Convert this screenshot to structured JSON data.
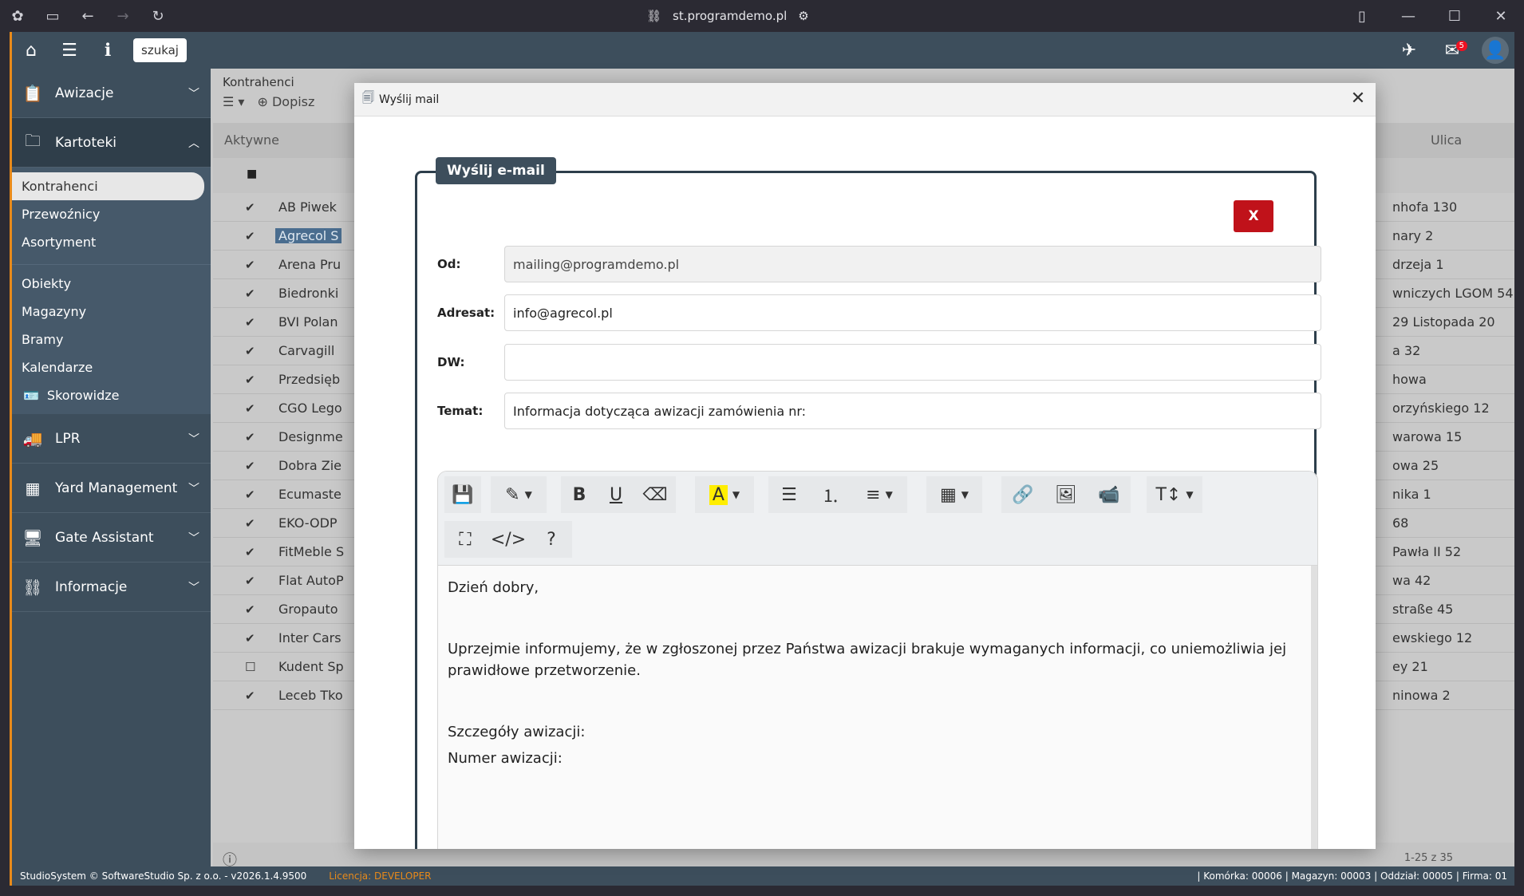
{
  "browser": {
    "url": "st.programdemo.pl"
  },
  "topbar": {
    "search_label": "szukaj",
    "mail_badge": "5"
  },
  "sidebar": {
    "sections": [
      {
        "label": "Awizacje"
      },
      {
        "label": "Kartoteki"
      },
      {
        "label": "LPR"
      },
      {
        "label": "Yard Management"
      },
      {
        "label": "Gate Assistant"
      },
      {
        "label": "Informacje"
      }
    ],
    "kartoteki_items": [
      "Kontrahenci",
      "Przewoźnicy",
      "Asortyment",
      "Obiekty",
      "Magazyny",
      "Bramy",
      "Kalendarze",
      "Skorowidze"
    ]
  },
  "content": {
    "breadcrumb": "Kontrahenci",
    "add_label": "Dopisz",
    "columns": {
      "active": "Aktywne",
      "street": "Ulica"
    },
    "rows": [
      {
        "name": "AB Piwek",
        "street": "nhofa 130",
        "checked": true
      },
      {
        "name": "Agrecol S",
        "street": "nary 2",
        "checked": true
      },
      {
        "name": "Arena Pru",
        "street": "drzeja 1",
        "checked": true
      },
      {
        "name": "Biedronki",
        "street": "wniczych LGOM 54",
        "checked": true
      },
      {
        "name": "BVI Polan",
        "street": "29 Listopada 20",
        "checked": true
      },
      {
        "name": "Carvagill",
        "street": "a 32",
        "checked": true
      },
      {
        "name": "Przedsięb",
        "street": "howa",
        "checked": true
      },
      {
        "name": "CGO Lego",
        "street": "orzyńskiego 12",
        "checked": true
      },
      {
        "name": "Designme",
        "street": "warowa 15",
        "checked": true
      },
      {
        "name": "Dobra Zie",
        "street": "owa 25",
        "checked": true
      },
      {
        "name": "Ecumaste",
        "street": "nika 1",
        "checked": true
      },
      {
        "name": "EKO-ODP",
        "street": "68",
        "checked": true
      },
      {
        "name": "FitMeble S",
        "street": "Pawła II 52",
        "checked": true
      },
      {
        "name": "Flat AutoP",
        "street": "wa 42",
        "checked": true
      },
      {
        "name": "Gropauto",
        "street": "straße 45",
        "checked": true
      },
      {
        "name": "Inter Cars",
        "street": "ewskiego 12",
        "checked": true
      },
      {
        "name": "Kudent Sp",
        "street": "ey 21",
        "checked": false
      },
      {
        "name": "Leceb Tko",
        "street": "ninowa 2",
        "checked": true
      }
    ],
    "pager_info": "1-25 z 35"
  },
  "status": {
    "copyright": "StudioSystem © SoftwareStudio Sp. z o.o. - v2026.1.4.9500",
    "license_label": "Licencja:",
    "license_value": "DEVELOPER",
    "right": "| Komórka: 00006 | Magazyn: 00003 | Oddział: 00005 | Firma: 01"
  },
  "modal": {
    "title": "Wyślij mail",
    "panel_title": "Wyślij e-mail",
    "x_label": "X",
    "fields": {
      "from_label": "Od:",
      "from_value": "mailing@programdemo.pl",
      "to_label": "Adresat:",
      "to_value": "info@agrecol.pl",
      "cc_label": "DW:",
      "cc_value": "",
      "subject_label": "Temat:",
      "subject_value": "Informacja dotycząca awizacji zamówienia nr:"
    },
    "body": {
      "greeting": "Dzień dobry,",
      "para1": "Uprzejmie informujemy, że w zgłoszonej przez Państwa awizacji brakuje wymaganych informacji, co uniemożliwia jej prawidłowe przetworzenie.",
      "details": "Szczegóły awizacji:",
      "number": "Numer awizacji:"
    }
  }
}
